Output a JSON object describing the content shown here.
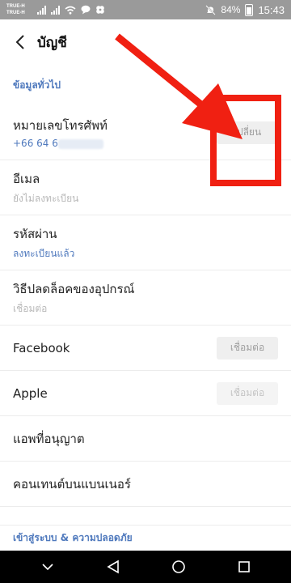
{
  "status": {
    "carrier1": "TRUE-H",
    "carrier2": "TRUE-H",
    "volte": "VoLTE",
    "battery": "84%",
    "time": "15:43"
  },
  "header": {
    "title": "บัญชี"
  },
  "sections": {
    "general": "ข้อมูลทั่วไป",
    "security": "เข้าสู่ระบบ & ความปลอดภัย"
  },
  "rows": {
    "phone": {
      "title": "หมายเลขโทรศัพท์",
      "value": "+66 64 6",
      "button": "เปลี่ยน"
    },
    "email": {
      "title": "อีเมล",
      "value": "ยังไม่ลงทะเบียน"
    },
    "password": {
      "title": "รหัสผ่าน",
      "value": "ลงทะเบียนแล้ว"
    },
    "unlock": {
      "title": "วิธีปลดล็อคของอุปกรณ์",
      "value": "เชื่อมต่อ"
    },
    "facebook": {
      "title": "Facebook",
      "button": "เชื่อมต่อ"
    },
    "apple": {
      "title": "Apple",
      "button": "เชื่อมต่อ"
    },
    "permitted_apps": {
      "title": "แอพที่อนุญาต"
    },
    "banner_content": {
      "title": "คอนเทนต์บนแบนเนอร์"
    }
  },
  "colors": {
    "accent": "#4f79bd",
    "annotation": "#f02012"
  }
}
